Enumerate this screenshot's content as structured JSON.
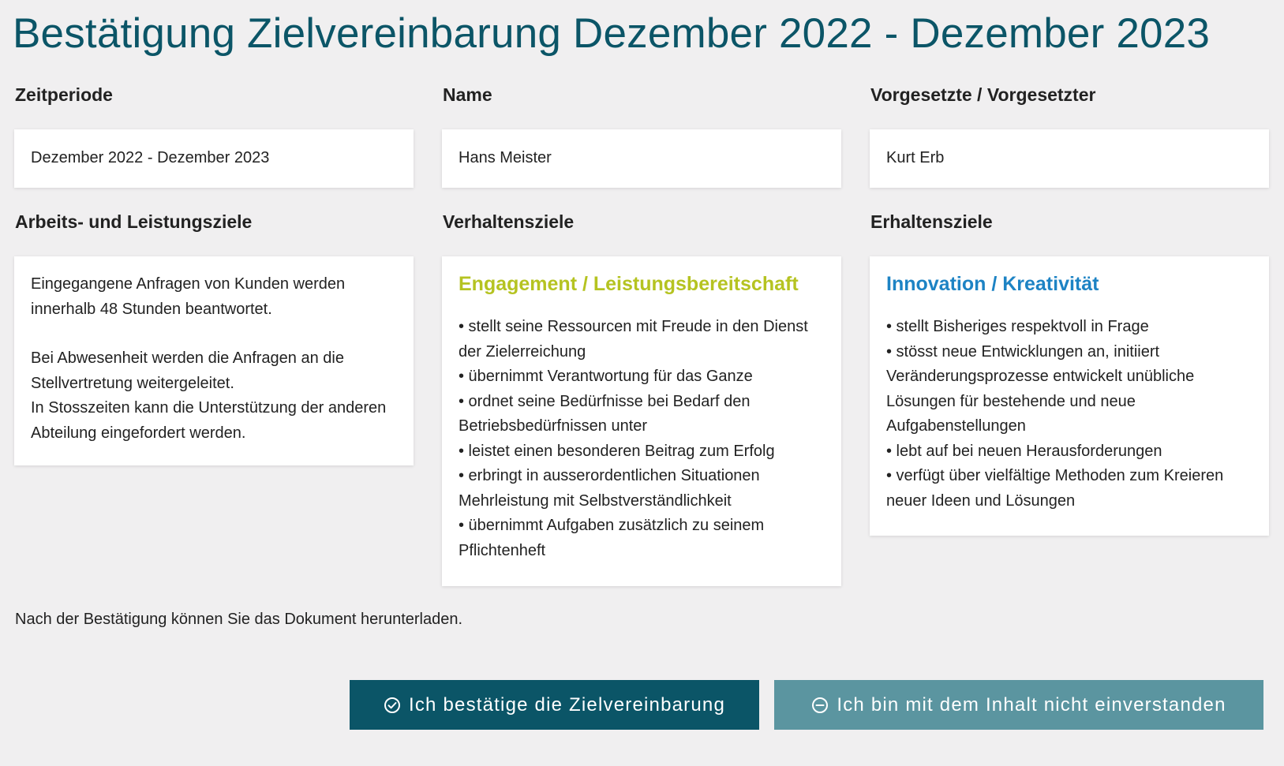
{
  "page": {
    "title": "Bestätigung Zielvereinbarung Dezember 2022 - Dezember 2023"
  },
  "colors": {
    "title": "#0b5567",
    "primary_button": "#0b5567",
    "secondary_button": "#5b95a0",
    "heading_green": "#b5c321",
    "heading_blue": "#1d83c4",
    "background": "#f0eff0"
  },
  "info": {
    "period": {
      "label": "Zeitperiode",
      "value": "Dezember 2022 - Dezember 2023"
    },
    "name": {
      "label": "Name",
      "value": "Hans Meister"
    },
    "supervisor": {
      "label": "Vorgesetzte / Vorgesetzter",
      "value": "Kurt Erb"
    }
  },
  "goals": {
    "work": {
      "label": "Arbeits- und Leistungsziele",
      "paragraphs": [
        [
          "Eingegangene Anfragen von Kunden werden innerhalb 48 Stunden beantwortet."
        ],
        [
          "Bei Abwesenheit werden die Anfragen an die Stellvertretung weitergeleitet.",
          "In Stosszeiten kann die Unterstützung der anderen Abteilung eingefordert werden."
        ]
      ]
    },
    "behavior": {
      "label": "Verhaltensziele",
      "heading": "Engagement / Leistungsbereitschaft",
      "bullets": [
        "• stellt seine Ressourcen mit Freude in den Dienst der Zielerreichung",
        "• übernimmt Verantwortung für das Ganze",
        "• ordnet seine Bedürfnisse bei Bedarf den Betriebsbedürfnissen unter",
        "• leistet einen besonderen Beitrag zum Erfolg",
        "• erbringt in ausserordentlichen Situationen Mehrleistung mit Selbstverständlichkeit",
        "• übernimmt Aufgaben zusätzlich zu seinem Pflichtenheft"
      ]
    },
    "maintenance": {
      "label": "Erhaltensziele",
      "heading": "Innovation / Kreativität",
      "bullets": [
        "• stellt Bisheriges respektvoll in Frage",
        "• stösst neue Entwicklungen an, initiiert Veränderungsprozesse entwickelt unübliche Lösungen für bestehende und neue Aufgabenstellungen",
        "• lebt auf bei neuen Herausforderungen",
        "• verfügt über vielfältige Methoden zum Kreieren neuer Ideen und Lösungen"
      ]
    }
  },
  "footer": {
    "note": "Nach der Bestätigung können Sie das Dokument herunterladen.",
    "confirm_button": {
      "label": "Ich bestätige die Zielvereinbarung",
      "icon": "check-circle-icon"
    },
    "reject_button": {
      "label": "Ich bin mit dem Inhalt nicht einverstanden",
      "icon": "minus-circle-icon"
    }
  }
}
